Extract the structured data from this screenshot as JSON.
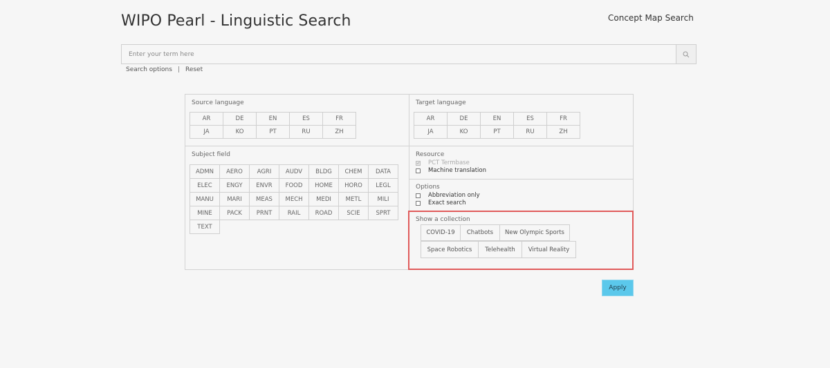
{
  "header": {
    "title": "WIPO Pearl - Linguistic Search",
    "concept_map_link": "Concept Map Search"
  },
  "search": {
    "placeholder": "Enter your term here",
    "search_icon": "magnifier-icon",
    "options_label": "Search options",
    "separator": "|",
    "reset_label": "Reset"
  },
  "source_language": {
    "label": "Source language",
    "languages": [
      "AR",
      "DE",
      "EN",
      "ES",
      "FR",
      "JA",
      "KO",
      "PT",
      "RU",
      "ZH"
    ]
  },
  "target_language": {
    "label": "Target language",
    "languages": [
      "AR",
      "DE",
      "EN",
      "ES",
      "FR",
      "JA",
      "KO",
      "PT",
      "RU",
      "ZH"
    ]
  },
  "subject_field": {
    "label": "Subject field",
    "fields": [
      "ADMN",
      "AERO",
      "AGRI",
      "AUDV",
      "BLDG",
      "CHEM",
      "DATA",
      "ELEC",
      "ENGY",
      "ENVR",
      "FOOD",
      "HOME",
      "HORO",
      "LEGL",
      "MANU",
      "MARI",
      "MEAS",
      "MECH",
      "MEDI",
      "METL",
      "MILI",
      "MINE",
      "PACK",
      "PRNT",
      "RAIL",
      "ROAD",
      "SCIE",
      "SPRT",
      "TEXT"
    ]
  },
  "resource": {
    "label": "Resource",
    "items": [
      {
        "label": "PCT Termbase",
        "checked": true,
        "disabled": true
      },
      {
        "label": "Machine translation",
        "checked": false,
        "disabled": false
      }
    ]
  },
  "options": {
    "label": "Options",
    "items": [
      {
        "label": "Abbreviation only",
        "checked": false
      },
      {
        "label": "Exact search",
        "checked": false
      }
    ]
  },
  "collection": {
    "label": "Show a collection",
    "items": [
      "COVID-19",
      "Chatbots",
      "New Olympic Sports",
      "Space Robotics",
      "Telehealth",
      "Virtual Reality"
    ]
  },
  "apply_label": "Apply",
  "colors": {
    "apply_bg": "#5bc8eb",
    "highlight": "#e05a5a",
    "background": "#f6f6f6"
  }
}
